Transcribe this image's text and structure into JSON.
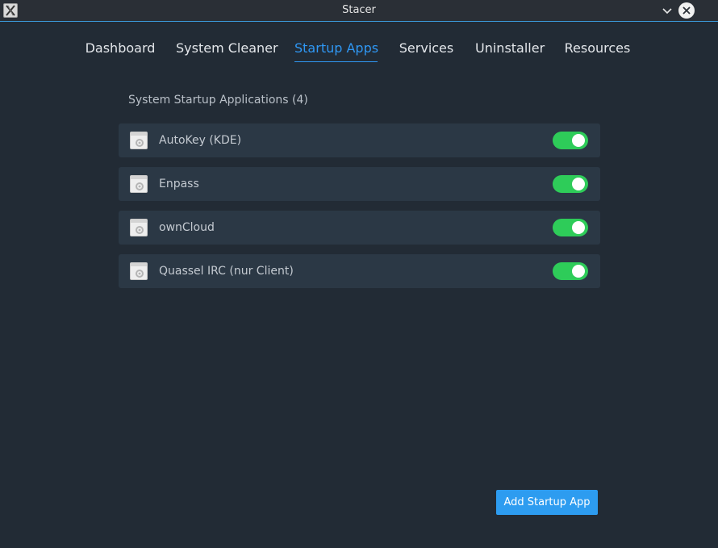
{
  "window": {
    "title": "Stacer"
  },
  "tabs": [
    {
      "label": "Dashboard",
      "active": false
    },
    {
      "label": "System Cleaner",
      "active": false
    },
    {
      "label": "Startup Apps",
      "active": true
    },
    {
      "label": "Services",
      "active": false
    },
    {
      "label": "Uninstaller",
      "active": false
    },
    {
      "label": "Resources",
      "active": false
    }
  ],
  "startup": {
    "heading": "System Startup Applications (4)",
    "apps": [
      {
        "name": "AutoKey (KDE)",
        "enabled": true,
        "icon": "generic-app-icon"
      },
      {
        "name": "Enpass",
        "enabled": true,
        "icon": "generic-app-icon"
      },
      {
        "name": "ownCloud",
        "enabled": true,
        "icon": "generic-app-icon"
      },
      {
        "name": "Quassel IRC (nur Client)",
        "enabled": true,
        "icon": "generic-app-icon"
      }
    ],
    "add_button": "Add Startup App"
  },
  "colors": {
    "background": "#222b35",
    "row": "#2b3845",
    "accent": "#2f97f3",
    "toggle_on": "#2ecc59",
    "button": "#2d9cf0"
  },
  "icons": {
    "app": "x-window-icon",
    "minimize": "chevron-down-icon",
    "close": "close-circle-icon"
  }
}
